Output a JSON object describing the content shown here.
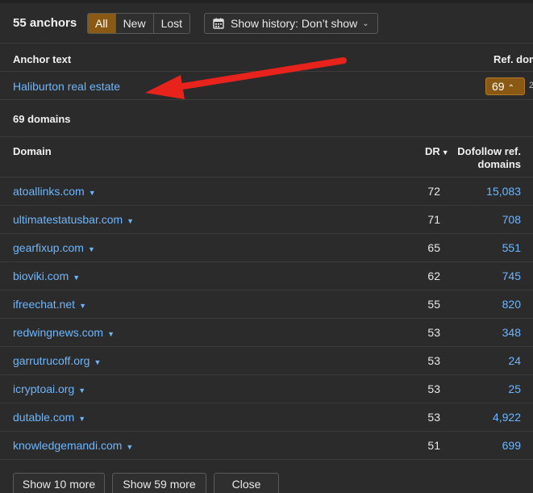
{
  "toolbar": {
    "anchors_count": "55 anchors",
    "filters": [
      {
        "label": "All",
        "active": true
      },
      {
        "label": "New",
        "active": false
      },
      {
        "label": "Lost",
        "active": false
      }
    ],
    "history_label": "Show history: Don’t show",
    "history_icon": "calendar-icon"
  },
  "anchor_table": {
    "col_anchor": "Anchor text",
    "col_ref": "Ref. domains",
    "rows": [
      {
        "text": "Haliburton real estate",
        "ref_domains": "69",
        "cut_value": "2"
      }
    ]
  },
  "domains": {
    "count_label": "69 domains",
    "col_domain": "Domain",
    "col_dr": "DR",
    "col_dofollow": "Dofollow ref. domains",
    "rows": [
      {
        "domain": "atoallinks.com",
        "dr": "72",
        "dofollow": "15,083"
      },
      {
        "domain": "ultimatestatusbar.com",
        "dr": "71",
        "dofollow": "708"
      },
      {
        "domain": "gearfixup.com",
        "dr": "65",
        "dofollow": "551"
      },
      {
        "domain": "bioviki.com",
        "dr": "62",
        "dofollow": "745"
      },
      {
        "domain": "ifreechat.net",
        "dr": "55",
        "dofollow": "820"
      },
      {
        "domain": "redwingnews.com",
        "dr": "53",
        "dofollow": "348"
      },
      {
        "domain": "garrutrucoff.org",
        "dr": "53",
        "dofollow": "24"
      },
      {
        "domain": "icryptoai.org",
        "dr": "53",
        "dofollow": "25"
      },
      {
        "domain": "dutable.com",
        "dr": "53",
        "dofollow": "4,922"
      },
      {
        "domain": "knowledgemandi.com",
        "dr": "51",
        "dofollow": "699"
      }
    ]
  },
  "footer": {
    "show_10": "Show 10 more",
    "show_59": "Show 59 more",
    "close": "Close"
  },
  "colors": {
    "background": "#2b2b2b",
    "link": "#6cb6ff",
    "accent": "#8a5a14",
    "annotation_arrow": "#e8231c"
  }
}
